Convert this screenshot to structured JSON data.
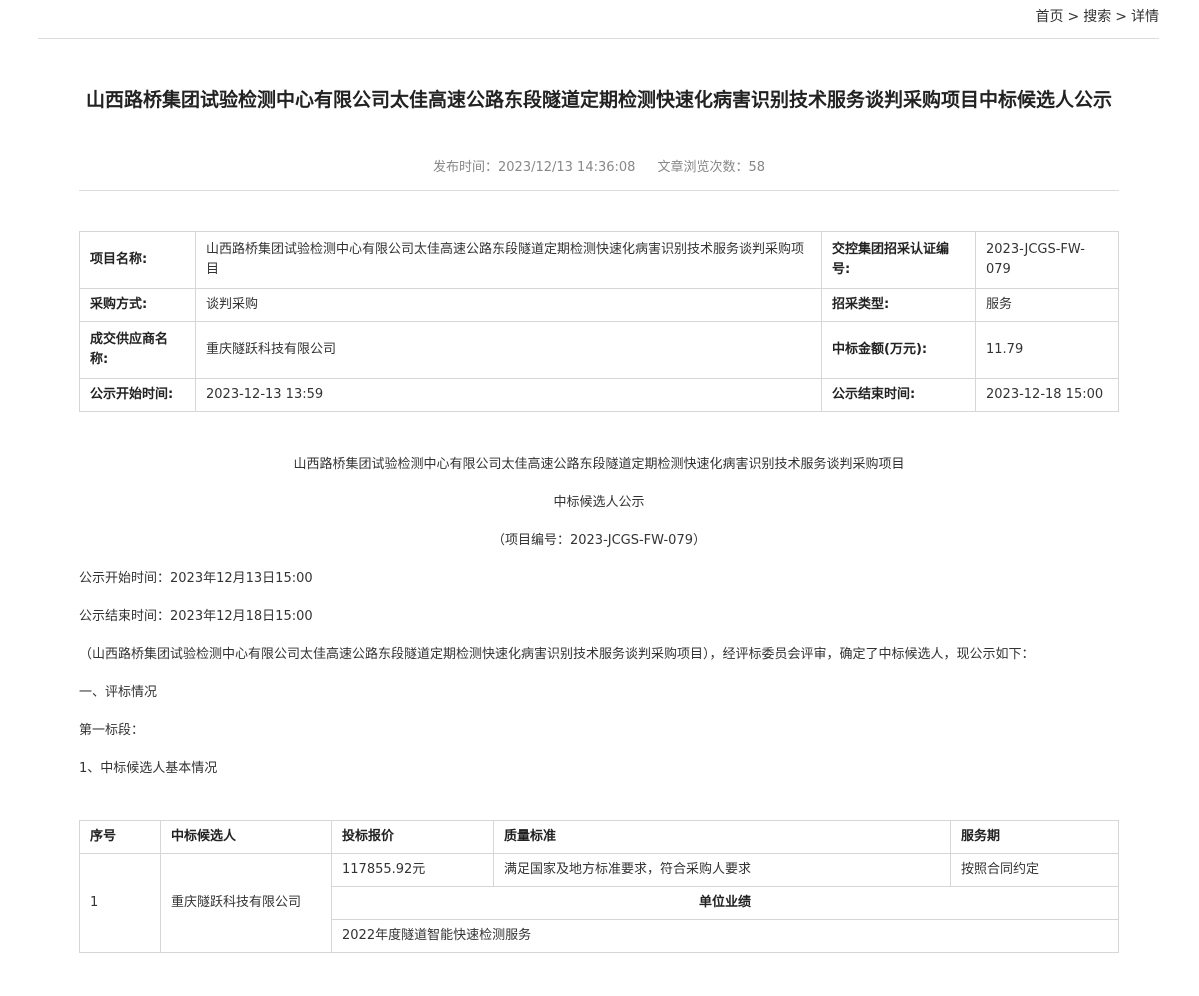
{
  "breadcrumb": {
    "home": "首页",
    "search": "搜索",
    "detail": "详情",
    "sep": ">"
  },
  "title": "山西路桥集团试验检测中心有限公司太佳高速公路东段隧道定期检测快速化病害识别技术服务谈判采购项目中标候选人公示",
  "meta": {
    "publish_label": "发布时间：",
    "publish_time": "2023/12/13 14:36:08",
    "views_label": "文章浏览次数：",
    "views": "58"
  },
  "info": {
    "project_name_label": "项目名称:",
    "project_name": "山西路桥集团试验检测中心有限公司太佳高速公路东段隧道定期检测快速化病害识别技术服务谈判采购项目",
    "cert_label": "交控集团招采认证编号:",
    "cert_value": "2023-JCGS-FW-079",
    "method_label": "采购方式:",
    "method_value": "谈判采购",
    "type_label": "招采类型:",
    "type_value": "服务",
    "supplier_label": "成交供应商名称:",
    "supplier_value": "重庆隧跃科技有限公司",
    "amount_label": "中标金额(万元):",
    "amount_value": "11.79",
    "start_label": "公示开始时间:",
    "start_value": "2023-12-13 13:59",
    "end_label": "公示结束时间:",
    "end_value": "2023-12-18 15:00"
  },
  "content": {
    "line1": "山西路桥集团试验检测中心有限公司太佳高速公路东段隧道定期检测快速化病害识别技术服务谈判采购项目",
    "line2": "中标候选人公示",
    "line3": "（项目编号：2023-JCGS-FW-079）",
    "line4": "公示开始时间：2023年12月13日15:00",
    "line5": "公示结束时间：2023年12月18日15:00",
    "line6": "（山西路桥集团试验检测中心有限公司太佳高速公路东段隧道定期检测快速化病害识别技术服务谈判采购项目），经评标委员会评审，确定了中标候选人，现公示如下：",
    "line7": "一、评标情况",
    "line8": "第一标段：",
    "line9": "1、中标候选人基本情况"
  },
  "candidates": {
    "headers": [
      "序号",
      "中标候选人",
      "投标报价",
      "质量标准",
      "服务期"
    ],
    "row": {
      "index": "1",
      "name": "重庆隧跃科技有限公司",
      "price": "117855.92元",
      "quality": "满足国家及地方标准要求，符合采购人要求",
      "period": "按照合同约定"
    },
    "performance_header": "单位业绩",
    "performance": "2022年度隧道智能快速检测服务"
  }
}
